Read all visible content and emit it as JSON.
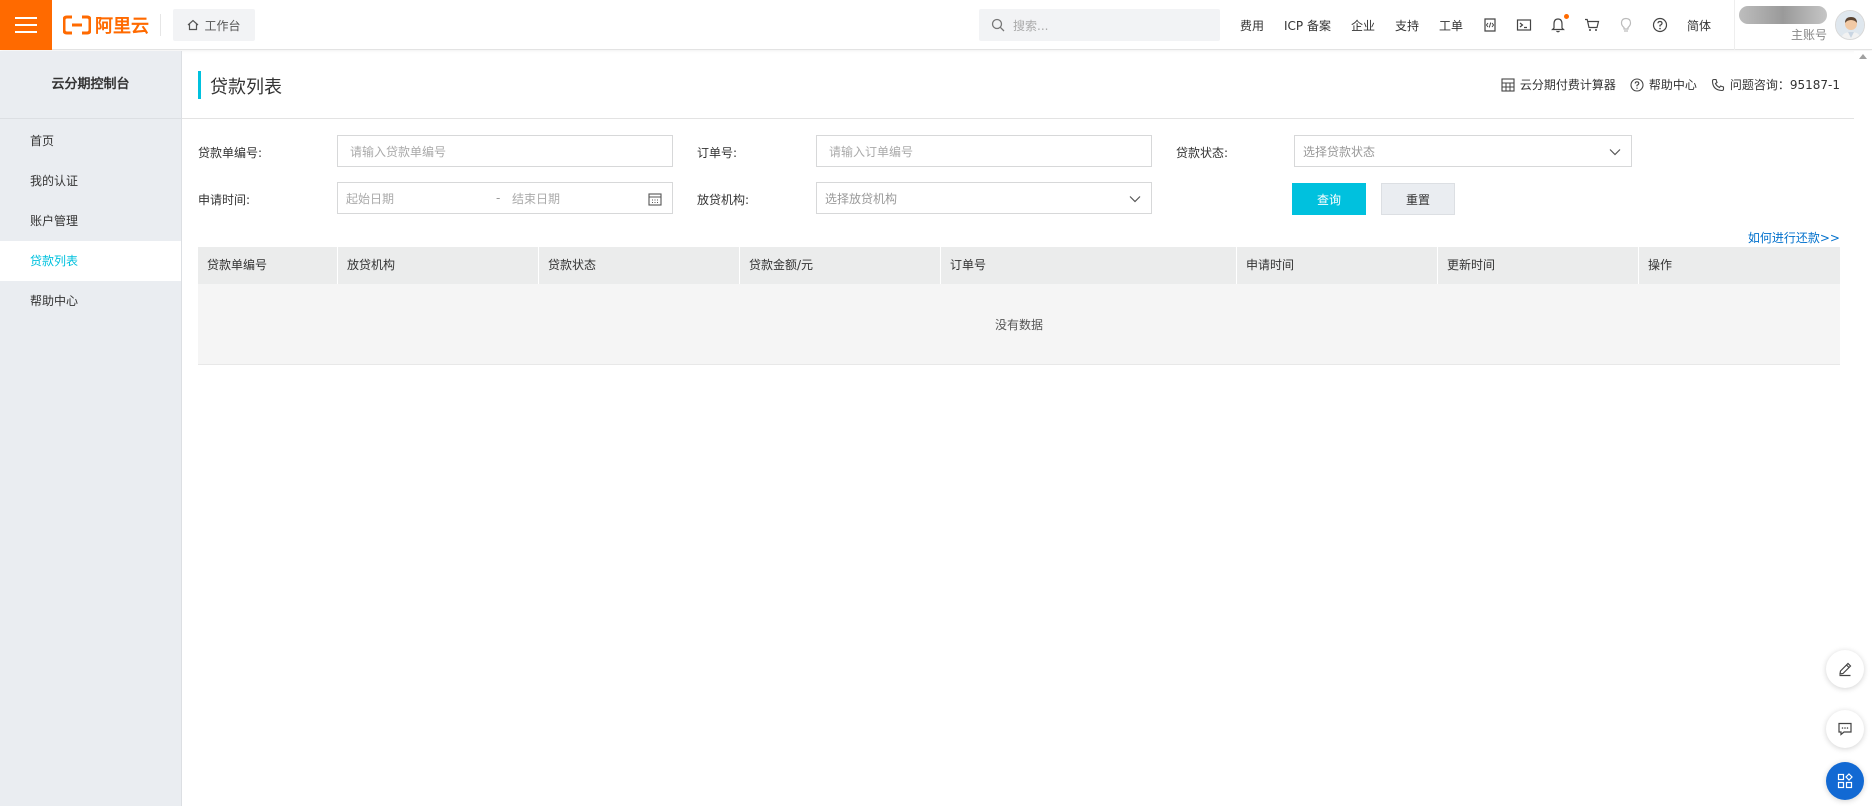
{
  "topbar": {
    "logo_text": "阿里云",
    "workbench_label": "工作台",
    "search_placeholder": "搜索...",
    "nav": [
      "费用",
      "ICP 备案",
      "企业",
      "支持",
      "工单"
    ],
    "lang_label": "简体",
    "account_role": "主账号",
    "colors": {
      "brand": "#ff6a00"
    }
  },
  "sidebar": {
    "title": "云分期控制台",
    "items": [
      {
        "label": "首页",
        "active": false
      },
      {
        "label": "我的认证",
        "active": false
      },
      {
        "label": "账户管理",
        "active": false
      },
      {
        "label": "贷款列表",
        "active": true
      },
      {
        "label": "帮助中心",
        "active": false
      }
    ]
  },
  "page": {
    "title": "贷款列表",
    "links": {
      "calculator": "云分期付费计算器",
      "help": "帮助中心",
      "hotline": "问题咨询：95187-1"
    }
  },
  "filters": {
    "loan_no_label": "贷款单编号:",
    "loan_no_placeholder": "请输入贷款单编号",
    "order_no_label": "订单号:",
    "order_no_placeholder": "请输入订单编号",
    "status_label": "贷款状态:",
    "status_placeholder": "选择贷款状态",
    "apply_time_label": "申请时间:",
    "start_date_placeholder": "起始日期",
    "date_sep": "-",
    "end_date_placeholder": "结束日期",
    "lender_label": "放贷机构:",
    "lender_placeholder": "选择放贷机构",
    "query_button": "查询",
    "reset_button": "重置"
  },
  "help_link": "如何进行还款>>",
  "table": {
    "columns": [
      "贷款单编号",
      "放贷机构",
      "贷款状态",
      "贷款金额/元",
      "订单号",
      "申请时间",
      "更新时间",
      "操作"
    ],
    "empty_text": "没有数据"
  },
  "accent_color": "#00c1de"
}
